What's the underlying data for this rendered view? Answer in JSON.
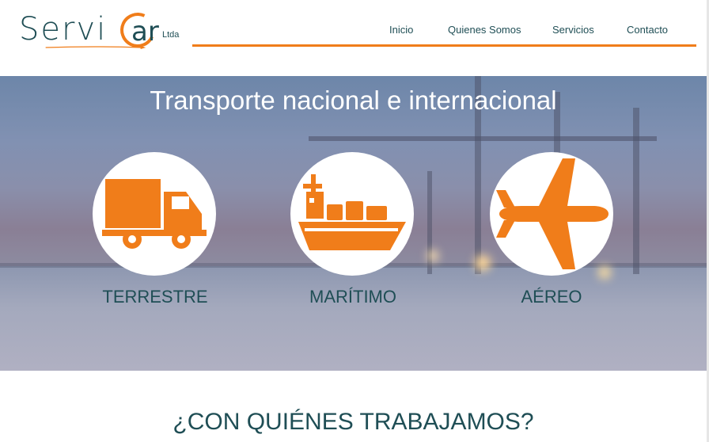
{
  "logo": {
    "text_main": "Servi",
    "text_tail": "ar",
    "suffix": "Ltda",
    "brand_orange": "#f07d1a",
    "brand_teal": "#1f4e55"
  },
  "nav": {
    "items": [
      "Inicio",
      "Quienes Somos",
      "Servicios",
      "Contacto"
    ]
  },
  "hero": {
    "title": "Transporte nacional e internacional",
    "modes": [
      {
        "label": "TERRESTRE",
        "icon": "truck-icon"
      },
      {
        "label": "MARÍTIMO",
        "icon": "cargo-ship-icon"
      },
      {
        "label": "AÉREO",
        "icon": "airplane-icon"
      }
    ]
  },
  "partners": {
    "title": "¿CON QUIÉNES TRABAJAMOS?"
  }
}
